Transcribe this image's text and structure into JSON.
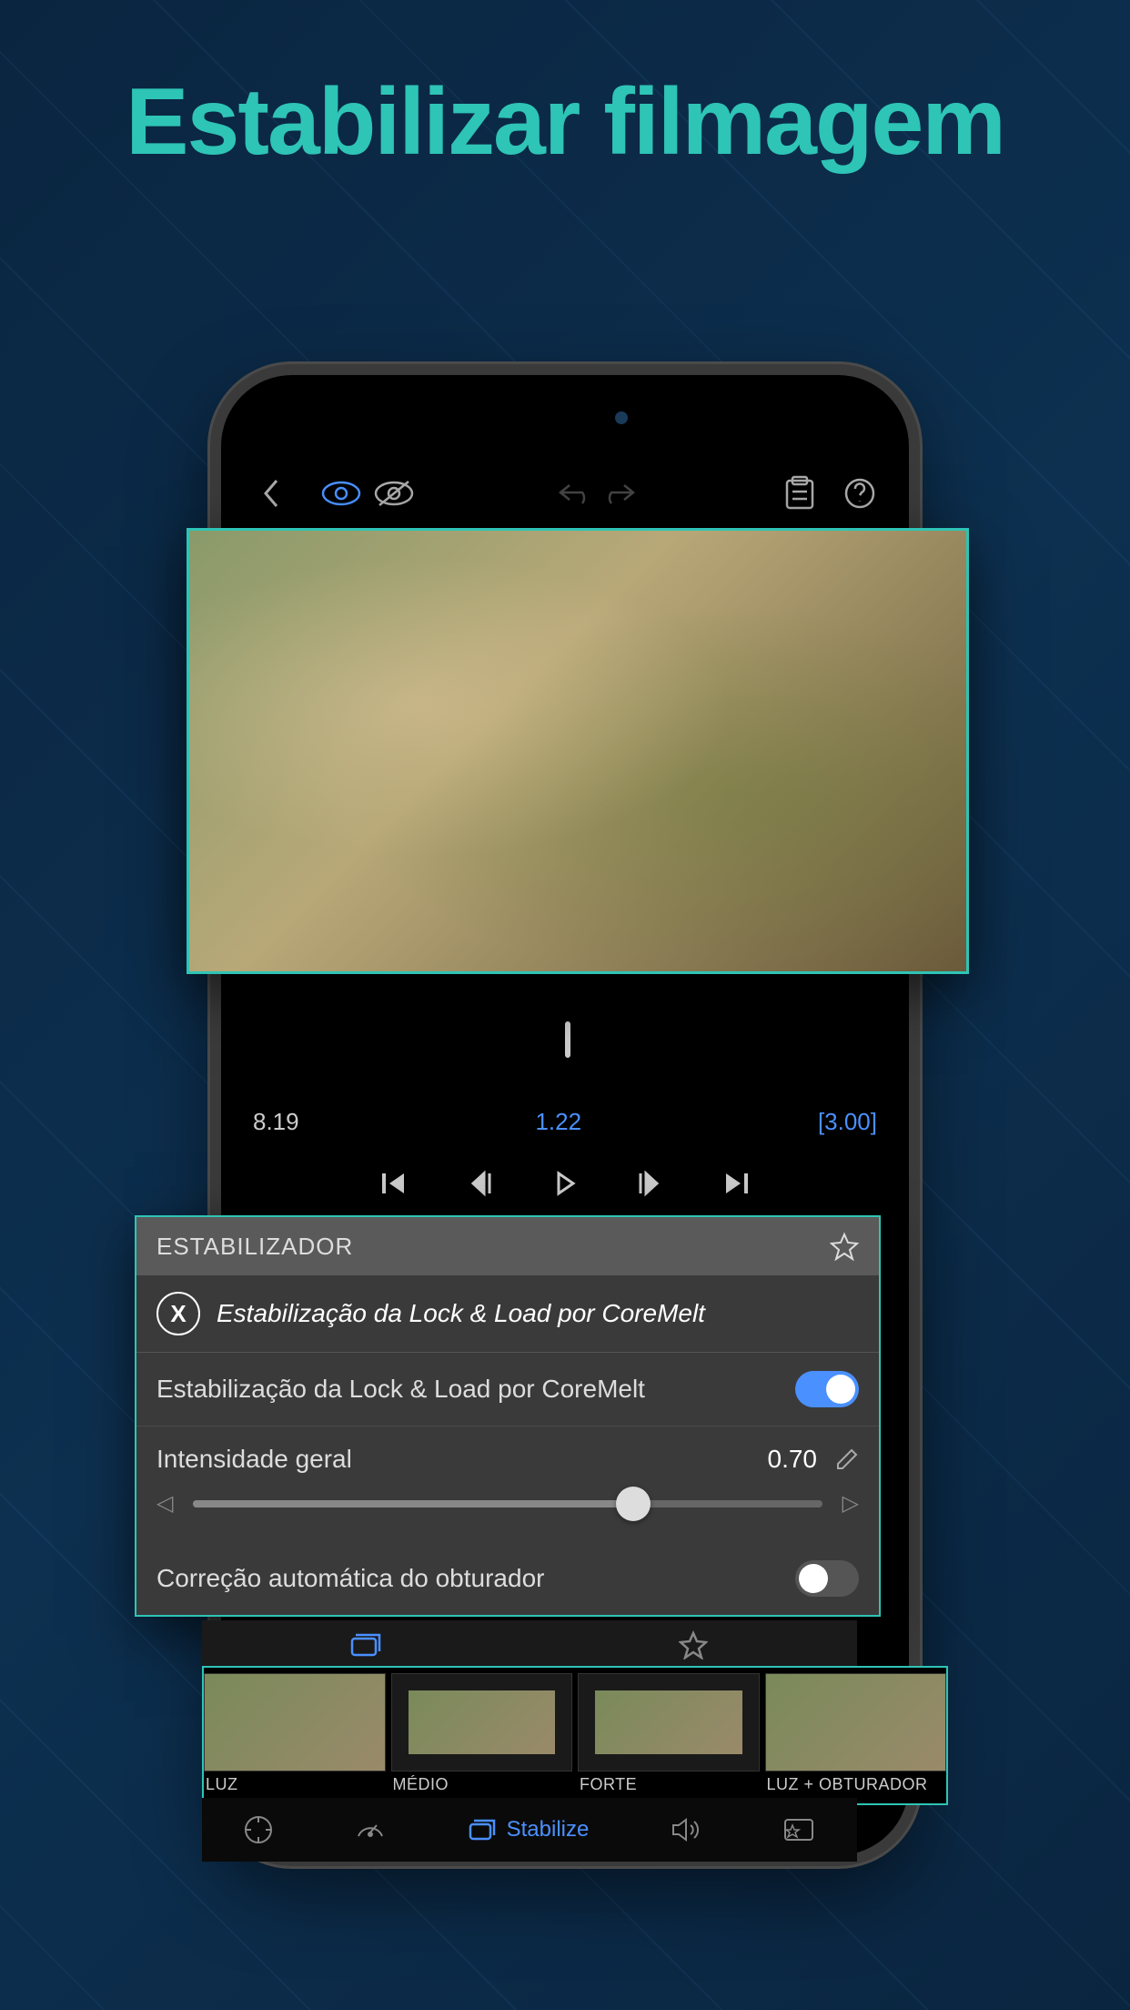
{
  "headline": "Estabilizar filmagem",
  "timeline": {
    "start": "8.19",
    "current": "1.22",
    "range": "[3.00]"
  },
  "panel": {
    "title": "ESTABILIZADOR",
    "subtitle": "Estabilização da Lock & Load por CoreMelt",
    "toggle_label": "Estabilização da Lock & Load por CoreMelt",
    "intensity_label": "Intensidade geral",
    "intensity_value": "0.70",
    "intensity_pct": 70,
    "shutter_label": "Correção automática do obturador"
  },
  "presets": [
    {
      "label": "LUZ",
      "style": "full"
    },
    {
      "label": "MÉDIO",
      "style": "dark"
    },
    {
      "label": "FORTE",
      "style": "dark"
    },
    {
      "label": "LUZ + OBTURADOR",
      "style": "full"
    }
  ],
  "bottom_bar": {
    "stabilize_label": "Stabilize"
  }
}
